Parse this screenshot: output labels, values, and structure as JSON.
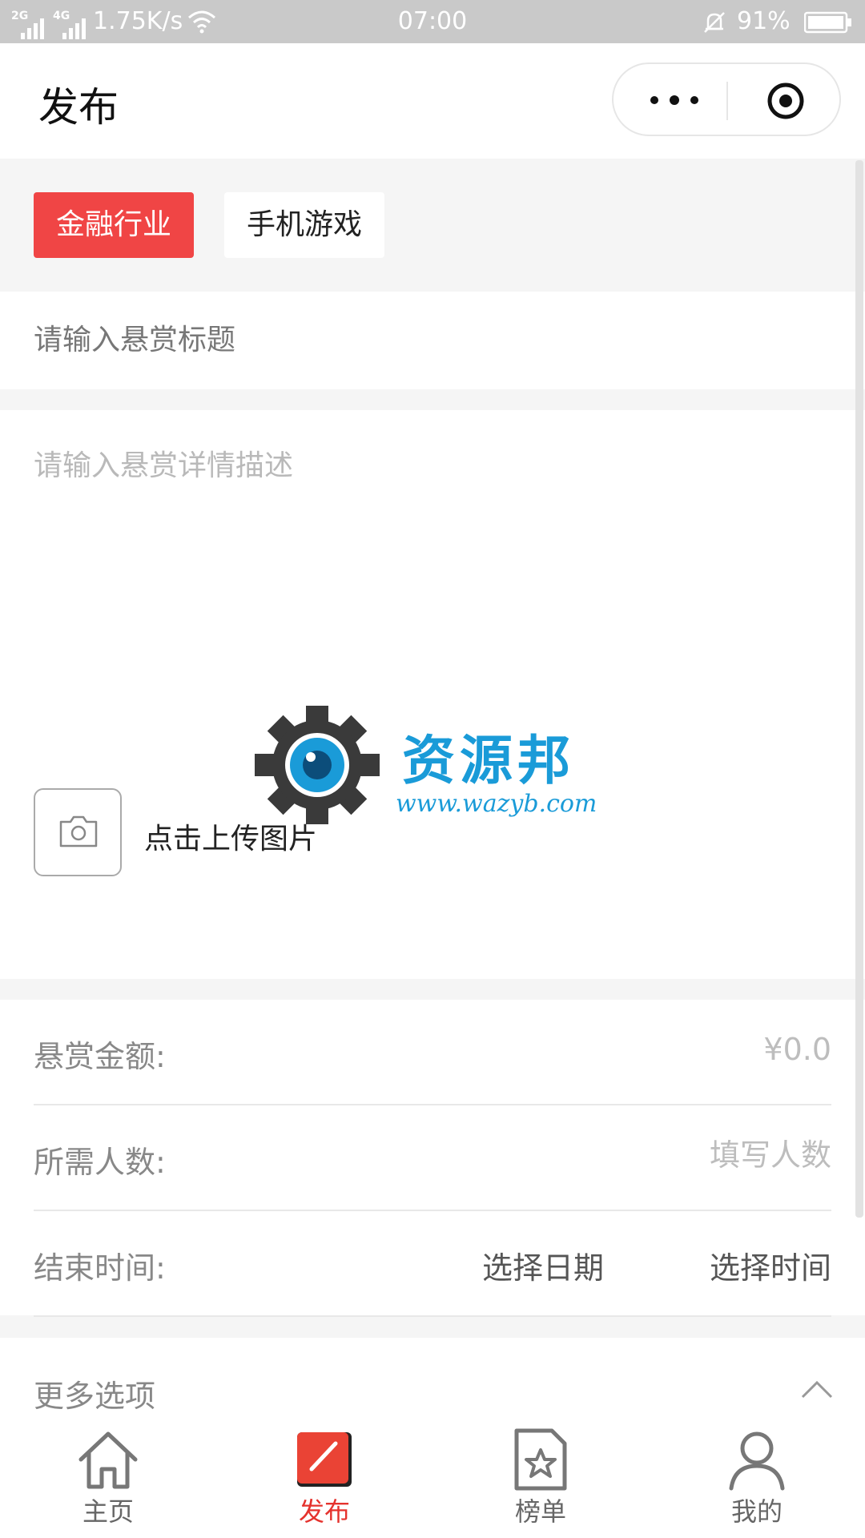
{
  "status_bar": {
    "net1": "2G",
    "net2": "4G",
    "speed": "1.75K/s",
    "time": "07:00",
    "battery": "91%"
  },
  "header": {
    "title": "发布",
    "icons": [
      "more-icon",
      "close-mini-program-icon"
    ]
  },
  "tags": [
    {
      "label": "金融行业",
      "selected": true
    },
    {
      "label": "手机游戏",
      "selected": false
    }
  ],
  "form": {
    "title_placeholder": "请输入悬赏标题",
    "desc_placeholder": "请输入悬赏详情描述",
    "upload_label": "点击上传图片",
    "amount_label": "悬赏金额:",
    "amount_placeholder": "¥0.0",
    "count_label": "所需人数:",
    "count_placeholder": "填写人数",
    "end_label": "结束时间:",
    "end_date": "选择日期",
    "end_time": "选择时间",
    "more_options": "更多选项"
  },
  "watermark": {
    "text": "资源邦",
    "url": "www.wazyb.com"
  },
  "tabbar": {
    "items": [
      {
        "label": "主页",
        "icon": "home-icon",
        "active": false
      },
      {
        "label": "发布",
        "icon": "publish-icon",
        "active": true
      },
      {
        "label": "榜单",
        "icon": "ranking-icon",
        "active": false
      },
      {
        "label": "我的",
        "icon": "profile-icon",
        "active": false
      }
    ]
  },
  "colors": {
    "accent": "#f04545",
    "tab_active": "#e5322d",
    "watermark": "#1a9bd8"
  }
}
